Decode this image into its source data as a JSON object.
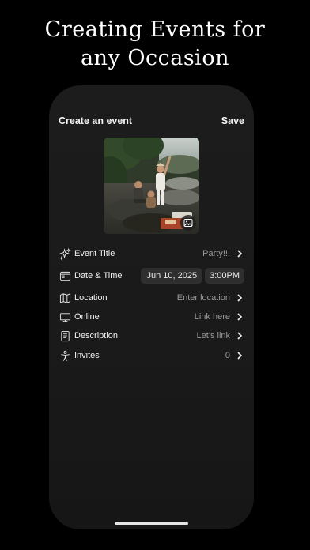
{
  "headline": {
    "line1": "Creating Events for",
    "line2": "any Occasion"
  },
  "nav": {
    "title": "Create an event",
    "save_label": "Save"
  },
  "event_photo": {
    "change_photo_icon": "image-icon"
  },
  "fields": [
    {
      "icon": "sparkles-icon",
      "label": "Event Title",
      "value": "Party!!!"
    },
    {
      "icon": "calendar-icon",
      "label": "Date & Time",
      "date": "Jun 10, 2025",
      "time": "3:00PM"
    },
    {
      "icon": "map-icon",
      "label": "Location",
      "value": "Enter location"
    },
    {
      "icon": "monitor-icon",
      "label": "Online",
      "value": "Link here"
    },
    {
      "icon": "document-icon",
      "label": "Description",
      "value": "Let's link"
    },
    {
      "icon": "person-icon",
      "label": "Invites",
      "value": "0"
    }
  ],
  "colors": {
    "background": "#000000",
    "card": "#1c1c1c",
    "pill": "#2f2f2f",
    "secondary_text": "#9a9a9a"
  }
}
